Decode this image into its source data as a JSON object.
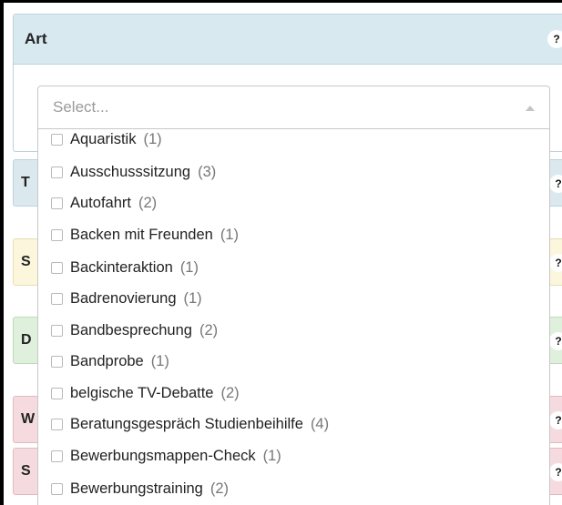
{
  "art_panel": {
    "title": "Art",
    "help": "?"
  },
  "sections": [
    {
      "letter": "T",
      "help": "?"
    },
    {
      "letter": "S",
      "help": "?"
    },
    {
      "letter": "D",
      "help": "?"
    },
    {
      "letter": "W",
      "help": "?"
    },
    {
      "letter": "S",
      "help": "?"
    }
  ],
  "select": {
    "placeholder": "Select..."
  },
  "options": [
    {
      "label": "Aquaristik",
      "count": "(1)"
    },
    {
      "label": "Ausschusssitzung",
      "count": "(3)"
    },
    {
      "label": "Autofahrt",
      "count": "(2)"
    },
    {
      "label": "Backen mit Freunden",
      "count": "(1)"
    },
    {
      "label": "Backinteraktion",
      "count": "(1)"
    },
    {
      "label": "Badrenovierung",
      "count": "(1)"
    },
    {
      "label": "Bandbesprechung",
      "count": "(2)"
    },
    {
      "label": "Bandprobe",
      "count": "(1)"
    },
    {
      "label": "belgische TV-Debatte",
      "count": "(2)"
    },
    {
      "label": "Beratungsgespräch Studienbeihilfe",
      "count": "(4)"
    },
    {
      "label": "Bewerbungsmappen-Check",
      "count": "(1)"
    },
    {
      "label": "Bewerbungstraining",
      "count": "(2)"
    }
  ]
}
